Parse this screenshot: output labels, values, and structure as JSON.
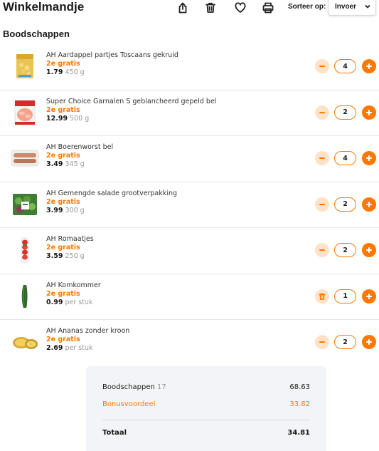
{
  "header": {
    "title": "Winkelmandje",
    "icons": [
      "share-icon",
      "trash-icon",
      "heart-icon",
      "print-icon"
    ],
    "sort_label": "Sorteer op:",
    "sort_value": "Invoer"
  },
  "section": {
    "title": "Boodschappen"
  },
  "items": [
    {
      "name": "AH Aardappel partjes Toscaans gekruid",
      "promo": "2e gratis",
      "price": "1.79",
      "unit": "450 g",
      "quantity": "4",
      "left_button": "minus-icon"
    },
    {
      "name": "Super Choice Garnalen S geblancheerd gepeld bel",
      "promo": "2e gratis",
      "price": "12.99",
      "unit": "500 g",
      "quantity": "2",
      "left_button": "minus-icon"
    },
    {
      "name": "AH Boerenworst bel",
      "promo": "2e gratis",
      "price": "3.49",
      "unit": "345 g",
      "quantity": "4",
      "left_button": "minus-icon"
    },
    {
      "name": "AH Gemengde salade grootverpakking",
      "promo": "2e gratis",
      "price": "3.99",
      "unit": "300 g",
      "quantity": "2",
      "left_button": "minus-icon"
    },
    {
      "name": "AH Romaatjes",
      "promo": "2e gratis",
      "price": "3.59",
      "unit": "250 g",
      "quantity": "2",
      "left_button": "minus-icon"
    },
    {
      "name": "AH Komkommer",
      "promo": "2e gratis",
      "price": "0.99",
      "unit": "per stuk",
      "quantity": "1",
      "left_button": "trash-icon"
    },
    {
      "name": "AH Ananas zonder kroon",
      "promo": "2e gratis",
      "price": "2.69",
      "unit": "per stuk",
      "quantity": "2",
      "left_button": "minus-icon"
    }
  ],
  "summary": {
    "boodschappen_label": "Boodschappen",
    "boodschappen_count": "17",
    "boodschappen_value": "68.63",
    "bonus_label": "Bonusvoordeel",
    "bonus_value": "33.82",
    "total_label": "Totaal",
    "total_value": "34.81"
  },
  "colors": {
    "accent": "#ff7800",
    "accent_light": "#ffe2c7",
    "summary_bg": "#f3f4f7",
    "muted_text": "#999999"
  }
}
